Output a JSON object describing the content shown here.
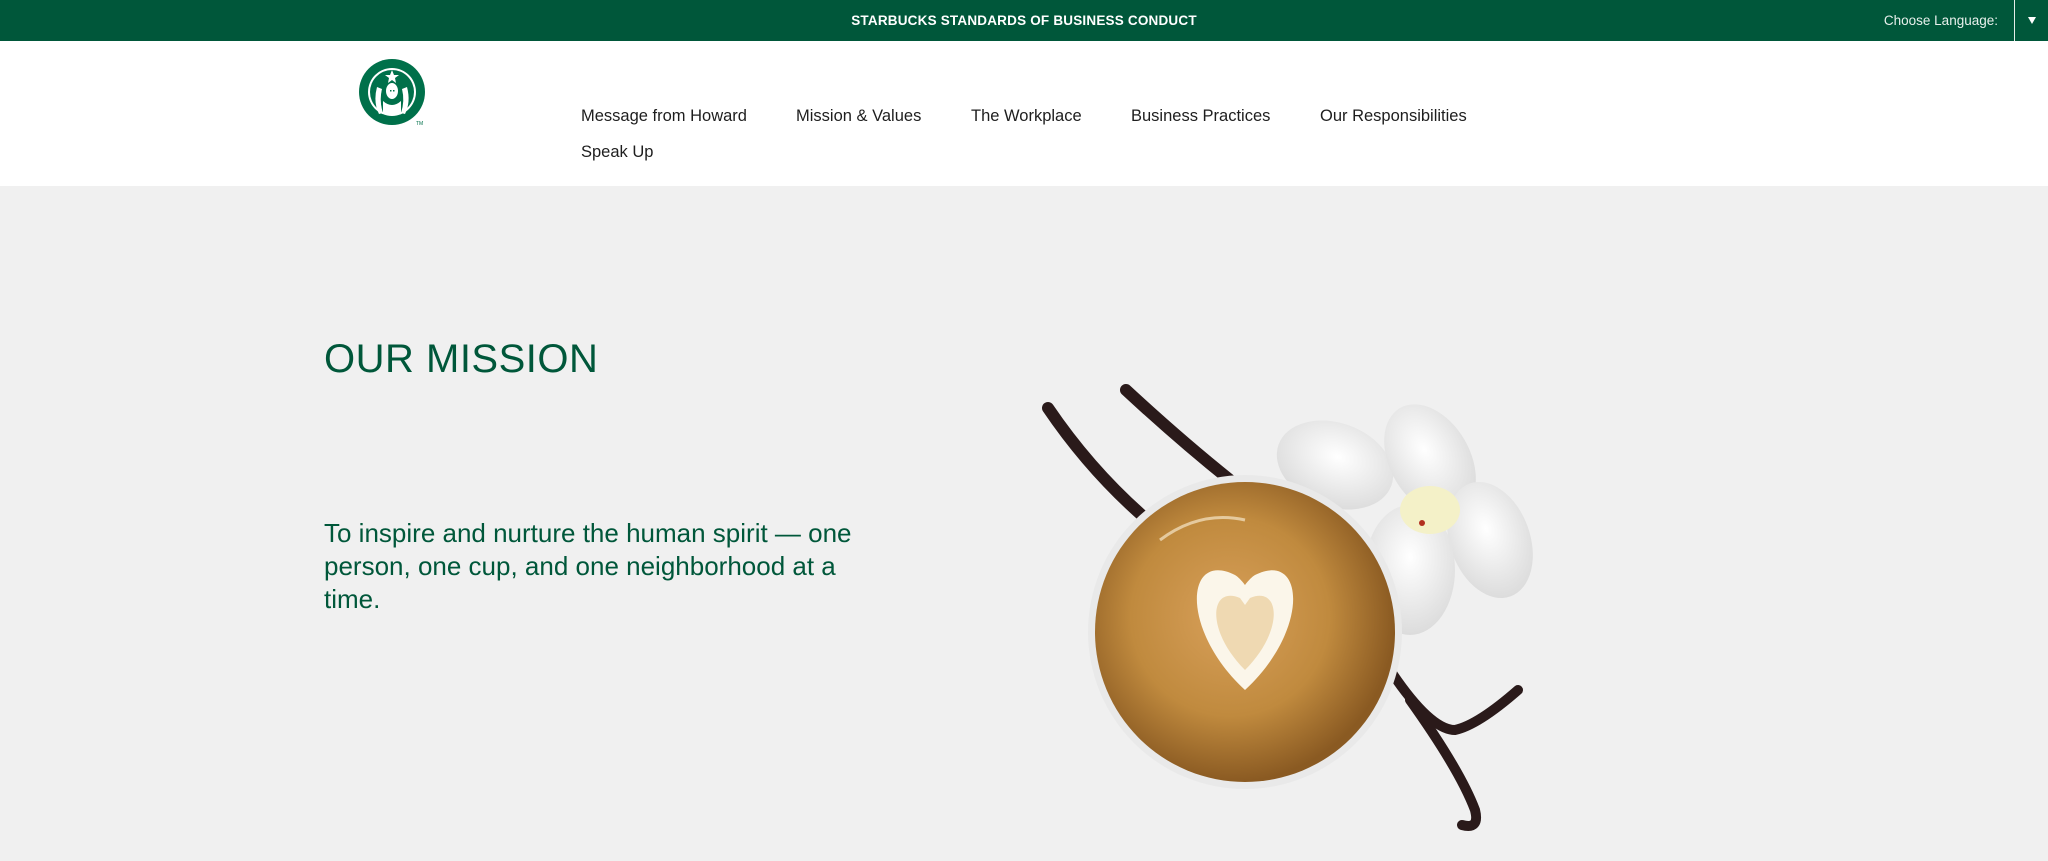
{
  "topbar": {
    "title": "STARBUCKS STANDARDS OF BUSINESS CONDUCT",
    "language_label": "Choose Language:",
    "language_toggle_icon": "caret-down-icon"
  },
  "header": {
    "logo_icon": "starbucks-siren-logo",
    "nav_items": [
      {
        "label": "Message from Howard"
      },
      {
        "label": "Mission & Values"
      },
      {
        "label": "The Workplace"
      },
      {
        "label": "Business Practices"
      },
      {
        "label": "Our Responsibilities"
      },
      {
        "label": "Speak Up"
      }
    ]
  },
  "hero": {
    "title": "OUR MISSION",
    "text": "To inspire and nurture the human spirit — one person, one cup, and one neighborhood at a time.",
    "image_subject": "latte-art-with-vanilla-flower"
  },
  "colors": {
    "brand_green": "#00573a",
    "background": "#f0f0f0",
    "header_bg": "#ffffff"
  }
}
